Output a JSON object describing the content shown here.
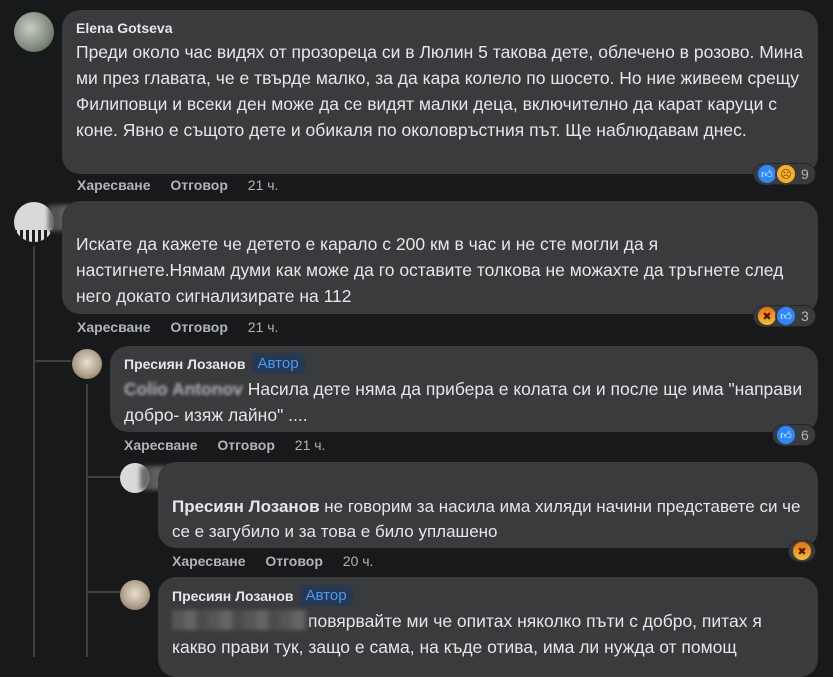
{
  "comments": [
    {
      "author": "Elena Gotseva",
      "text": "Преди около час видях от прозореца си в Люлин 5 такова дете, облечено в розово. Мина ми през главата, че е твърде малко, за да кара колело по шосето. Но ние живеем срещу Филиповци и всеки ден може да се видят малки деца, включително да карат каруци с коне. Явно е същото дете и обикаля по околовръстния път. Ще наблюдавам днес.",
      "like_label": "Харесване",
      "reply_label": "Отговор",
      "time": "21 ч.",
      "reaction_count": "9",
      "reactions": [
        "like",
        "sad"
      ]
    },
    {
      "author": "",
      "text": "Искате да кажете че детето е карало с 200 км в час и не сте могли да я настигнете.Нямам думи как може да го оставите толкова не можахте да тръгнете след него докато сигнализирате на 112",
      "like_label": "Харесване",
      "reply_label": "Отговор",
      "time": "21 ч.",
      "reaction_count": "3",
      "reactions": [
        "angry",
        "like"
      ]
    },
    {
      "author": "Пресиян Лозанов",
      "badge": "Автор",
      "mention": "Colio Antonov",
      "text": "Насила дете няма да прибера е колата си и после ще има \"направи добро- изяж лайно\" ....",
      "like_label": "Харесване",
      "reply_label": "Отговор",
      "time": "21 ч.",
      "reaction_count": "6",
      "reactions": [
        "like"
      ]
    },
    {
      "author": "",
      "mention": "Пресиян Лозанов",
      "text": "не говорим за насила има хиляди начини представете си че се е загубило и за това е било уплашено",
      "like_label": "Харесване",
      "reply_label": "Отговор",
      "time": "20 ч.",
      "reactions": [
        "angry"
      ]
    },
    {
      "author": "Пресиян Лозанов",
      "badge": "Автор",
      "text": "повярвайте ми че опитах няколко пъти с добро, питах я какво прави тук, защо е сама, на къде отива, има ли нужда от помощ"
    }
  ],
  "colors": {
    "background": "#18191a",
    "bubble": "#3a3b3c",
    "text": "#e4e6eb",
    "secondary": "#b0b3b8",
    "author_badge": "#4599ff"
  }
}
